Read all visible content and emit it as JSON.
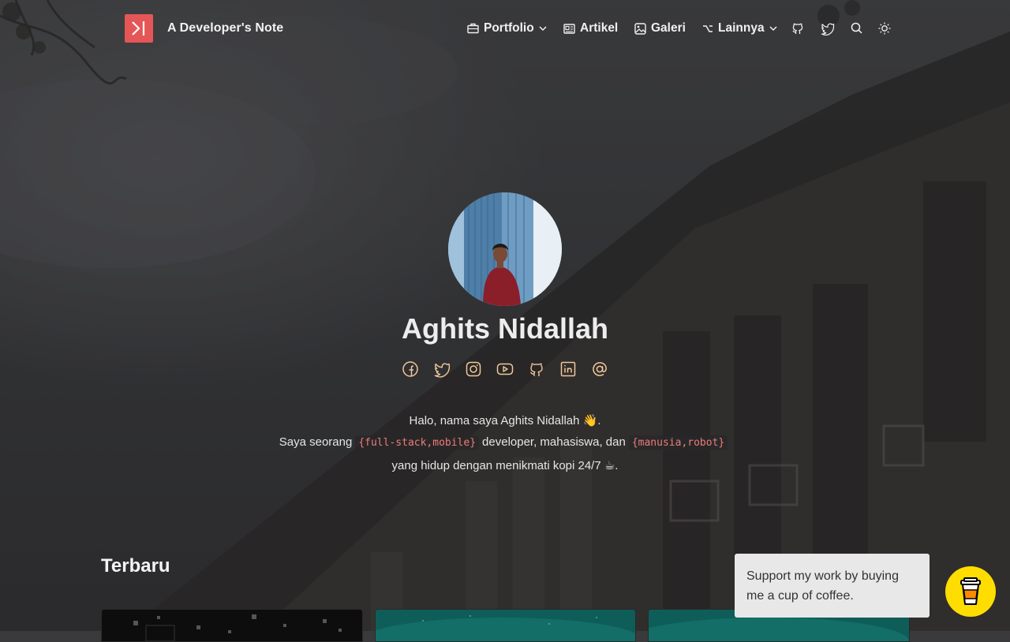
{
  "site": {
    "title": "A Developer's Note"
  },
  "nav": {
    "items": [
      {
        "label": "Portfolio",
        "icon": "briefcase-icon",
        "dropdown": true
      },
      {
        "label": "Artikel",
        "icon": "newspaper-icon",
        "dropdown": false
      },
      {
        "label": "Galeri",
        "icon": "image-icon",
        "dropdown": false
      },
      {
        "label": "Lainnya",
        "icon": "option-icon",
        "dropdown": true
      }
    ],
    "icons": [
      "github-icon",
      "twitter-icon",
      "search-icon",
      "sun-icon"
    ]
  },
  "hero": {
    "name": "Aghits Nidallah",
    "socials": [
      "facebook-icon",
      "twitter-icon",
      "instagram-icon",
      "youtube-icon",
      "github-icon",
      "linkedin-icon",
      "at-email-icon"
    ],
    "bio": {
      "line1": "Halo, nama saya Aghits Nidallah 👋.",
      "line2_a": "Saya seorang",
      "line2_code1": "{full-stack,mobile}",
      "line2_b": "developer, mahasiswa, dan",
      "line2_code2": "{manusia,robot}",
      "line3": "yang hidup dengan menikmati kopi 24/7 ☕."
    }
  },
  "latest": {
    "title": "Terbaru"
  },
  "support": {
    "tooltip": "Support my work by buying me a cup of coffee."
  },
  "colors": {
    "accent": "#e55656",
    "code": "#f07a7a",
    "bmc": "#ffdd00",
    "social": "#f0c89a"
  }
}
